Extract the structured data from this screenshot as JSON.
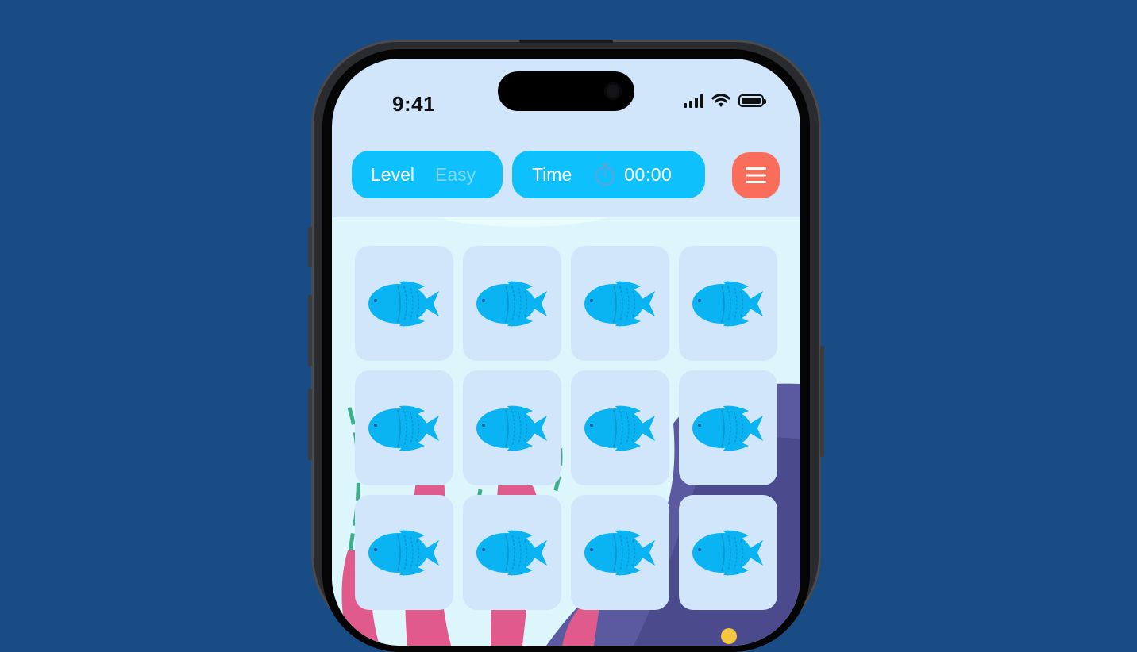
{
  "status_bar": {
    "time": "9:41"
  },
  "header": {
    "level_label": "Level",
    "level_value": "Easy",
    "time_label": "Time",
    "timer_value": "00:00",
    "menu_icon": "hamburger-menu-icon"
  },
  "colors": {
    "background": "#194c85",
    "pill": "#0ec0fc",
    "menu_button": "#fb6d5b",
    "card": "#d2e6fb",
    "fish": "#0ab3f2"
  },
  "board": {
    "columns": 4,
    "rows_visible": 3,
    "card_icon": "fish-icon",
    "cards": [
      {
        "face": "hidden"
      },
      {
        "face": "hidden"
      },
      {
        "face": "hidden"
      },
      {
        "face": "hidden"
      },
      {
        "face": "hidden"
      },
      {
        "face": "hidden"
      },
      {
        "face": "hidden"
      },
      {
        "face": "hidden"
      },
      {
        "face": "hidden"
      },
      {
        "face": "hidden"
      },
      {
        "face": "hidden"
      },
      {
        "face": "hidden"
      }
    ]
  }
}
